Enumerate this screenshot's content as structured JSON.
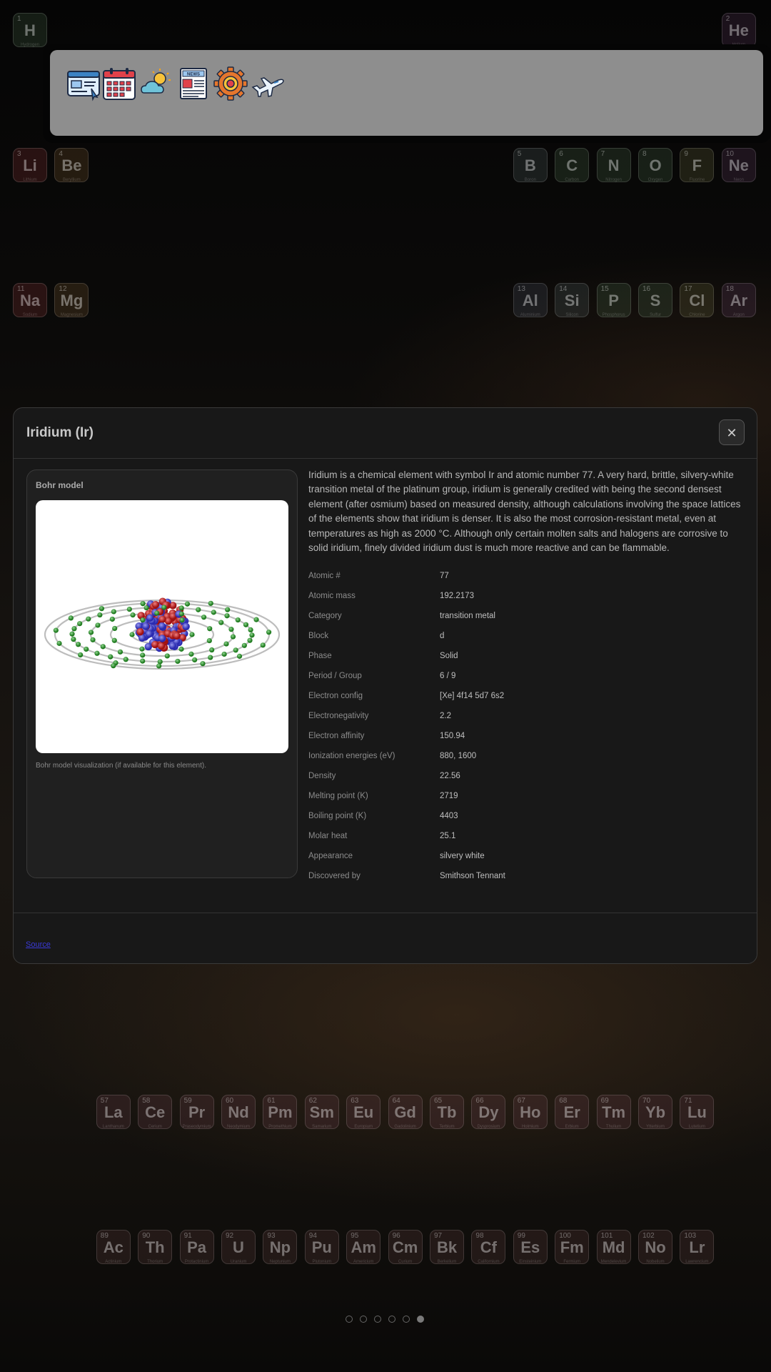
{
  "app_launcher": {
    "apps": [
      {
        "name": "browser-app-icon"
      },
      {
        "name": "calendar-app-icon"
      },
      {
        "name": "weather-app-icon"
      },
      {
        "name": "news-app-icon",
        "label": "NEWS"
      },
      {
        "name": "settings-app-icon"
      },
      {
        "name": "travel-app-icon"
      }
    ]
  },
  "table_tiles": [
    {
      "num": "1",
      "sym": "H",
      "name": "Hydrogen",
      "cls": "t-nonmetal"
    },
    {
      "num": "2",
      "sym": "He",
      "name": "Helium",
      "cls": "t-noble"
    },
    {
      "num": "3",
      "sym": "Li",
      "name": "Lithium",
      "cls": "t-alkali"
    },
    {
      "num": "4",
      "sym": "Be",
      "name": "Beryllium",
      "cls": "t-earth"
    },
    {
      "num": "5",
      "sym": "B",
      "name": "Boron",
      "cls": "t-metalloid"
    },
    {
      "num": "6",
      "sym": "C",
      "name": "Carbon",
      "cls": "t-nonmetal"
    },
    {
      "num": "7",
      "sym": "N",
      "name": "Nitrogen",
      "cls": "t-nonmetal"
    },
    {
      "num": "8",
      "sym": "O",
      "name": "Oxygen",
      "cls": "t-nonmetal"
    },
    {
      "num": "9",
      "sym": "F",
      "name": "Fluorine",
      "cls": "t-halogen"
    },
    {
      "num": "10",
      "sym": "Ne",
      "name": "Neon",
      "cls": "t-noble"
    },
    {
      "num": "11",
      "sym": "Na",
      "name": "Sodium",
      "cls": "t-alkali"
    },
    {
      "num": "12",
      "sym": "Mg",
      "name": "Magnesium",
      "cls": "t-earth"
    },
    {
      "num": "13",
      "sym": "Al",
      "name": "Aluminium",
      "cls": "t-post"
    },
    {
      "num": "14",
      "sym": "Si",
      "name": "Silicon",
      "cls": "t-metalloid"
    },
    {
      "num": "15",
      "sym": "P",
      "name": "Phosphorus",
      "cls": "t-nonmetal"
    },
    {
      "num": "16",
      "sym": "S",
      "name": "Sulfur",
      "cls": "t-nonmetal"
    },
    {
      "num": "17",
      "sym": "Cl",
      "name": "Chlorine",
      "cls": "t-halogen"
    },
    {
      "num": "18",
      "sym": "Ar",
      "name": "Argon",
      "cls": "t-noble"
    },
    {
      "num": "57",
      "sym": "La",
      "name": "Lanthanum",
      "cls": "t-lanth"
    },
    {
      "num": "58",
      "sym": "Ce",
      "name": "Cerium",
      "cls": "t-lanth"
    },
    {
      "num": "59",
      "sym": "Pr",
      "name": "Praseodymium",
      "cls": "t-lanth"
    },
    {
      "num": "60",
      "sym": "Nd",
      "name": "Neodymium",
      "cls": "t-lanth"
    },
    {
      "num": "61",
      "sym": "Pm",
      "name": "Promethium",
      "cls": "t-lanth"
    },
    {
      "num": "62",
      "sym": "Sm",
      "name": "Samarium",
      "cls": "t-lanth"
    },
    {
      "num": "63",
      "sym": "Eu",
      "name": "Europium",
      "cls": "t-lanth"
    },
    {
      "num": "64",
      "sym": "Gd",
      "name": "Gadolinium",
      "cls": "t-lanth"
    },
    {
      "num": "65",
      "sym": "Tb",
      "name": "Terbium",
      "cls": "t-lanth"
    },
    {
      "num": "66",
      "sym": "Dy",
      "name": "Dysprosium",
      "cls": "t-lanth"
    },
    {
      "num": "67",
      "sym": "Ho",
      "name": "Holmium",
      "cls": "t-lanth"
    },
    {
      "num": "68",
      "sym": "Er",
      "name": "Erbium",
      "cls": "t-lanth"
    },
    {
      "num": "69",
      "sym": "Tm",
      "name": "Thulium",
      "cls": "t-lanth"
    },
    {
      "num": "70",
      "sym": "Yb",
      "name": "Ytterbium",
      "cls": "t-lanth"
    },
    {
      "num": "71",
      "sym": "Lu",
      "name": "Lutetium",
      "cls": "t-lanth"
    },
    {
      "num": "89",
      "sym": "Ac",
      "name": "Actinium",
      "cls": "t-act"
    },
    {
      "num": "90",
      "sym": "Th",
      "name": "Thorium",
      "cls": "t-act"
    },
    {
      "num": "91",
      "sym": "Pa",
      "name": "Protactinium",
      "cls": "t-act"
    },
    {
      "num": "92",
      "sym": "U",
      "name": "Uranium",
      "cls": "t-act"
    },
    {
      "num": "93",
      "sym": "Np",
      "name": "Neptunium",
      "cls": "t-act"
    },
    {
      "num": "94",
      "sym": "Pu",
      "name": "Plutonium",
      "cls": "t-act"
    },
    {
      "num": "95",
      "sym": "Am",
      "name": "Americium",
      "cls": "t-act"
    },
    {
      "num": "96",
      "sym": "Cm",
      "name": "Curium",
      "cls": "t-act"
    },
    {
      "num": "97",
      "sym": "Bk",
      "name": "Berkelium",
      "cls": "t-act"
    },
    {
      "num": "98",
      "sym": "Cf",
      "name": "Californium",
      "cls": "t-act"
    },
    {
      "num": "99",
      "sym": "Es",
      "name": "Einsteinium",
      "cls": "t-act"
    },
    {
      "num": "100",
      "sym": "Fm",
      "name": "Fermium",
      "cls": "t-act"
    },
    {
      "num": "101",
      "sym": "Md",
      "name": "Mendelevium",
      "cls": "t-act"
    },
    {
      "num": "102",
      "sym": "No",
      "name": "Nobelium",
      "cls": "t-act"
    },
    {
      "num": "103",
      "sym": "Lr",
      "name": "Lawrencium",
      "cls": "t-act"
    }
  ],
  "modal": {
    "title": "Iridium (Ir)",
    "close_label": "✕",
    "bohr_title": "Bohr model",
    "bohr_caption": "Bohr model visualization (if available for this element).",
    "description": "Iridium is a chemical element with symbol Ir and atomic number 77. A very hard, brittle, silvery-white transition metal of the platinum group, iridium is generally credited with being the second densest element (after osmium) based on measured density, although calculations involving the space lattices of the elements show that iridium is denser. It is also the most corrosion-resistant metal, even at temperatures as high as 2000 °C. Although only certain molten salts and halogens are corrosive to solid iridium, finely divided iridium dust is much more reactive and can be flammable.",
    "properties": [
      {
        "label": "Atomic #",
        "value": "77"
      },
      {
        "label": "Atomic mass",
        "value": "192.2173"
      },
      {
        "label": "Category",
        "value": "transition metal"
      },
      {
        "label": "Block",
        "value": "d"
      },
      {
        "label": "Phase",
        "value": "Solid"
      },
      {
        "label": "Period / Group",
        "value": "6 / 9"
      },
      {
        "label": "Electron config",
        "value": "[Xe] 4f14 5d7 6s2"
      },
      {
        "label": "Electronegativity",
        "value": "2.2"
      },
      {
        "label": "Electron affinity",
        "value": "150.94"
      },
      {
        "label": "Ionization energies (eV)",
        "value": "880, 1600"
      },
      {
        "label": "Density",
        "value": "22.56"
      },
      {
        "label": "Melting point (K)",
        "value": "2719"
      },
      {
        "label": "Boiling point (K)",
        "value": "4403"
      },
      {
        "label": "Molar heat",
        "value": "25.1"
      },
      {
        "label": "Appearance",
        "value": "silvery white"
      },
      {
        "label": "Discovered by",
        "value": "Smithson Tennant"
      }
    ],
    "source_label": "Source"
  },
  "pagination": {
    "total": 6,
    "active": 6
  },
  "colors": {
    "launcher_bg": "#8e8e8e",
    "modal_bg": "#181818",
    "link": "#3a3ad8"
  }
}
